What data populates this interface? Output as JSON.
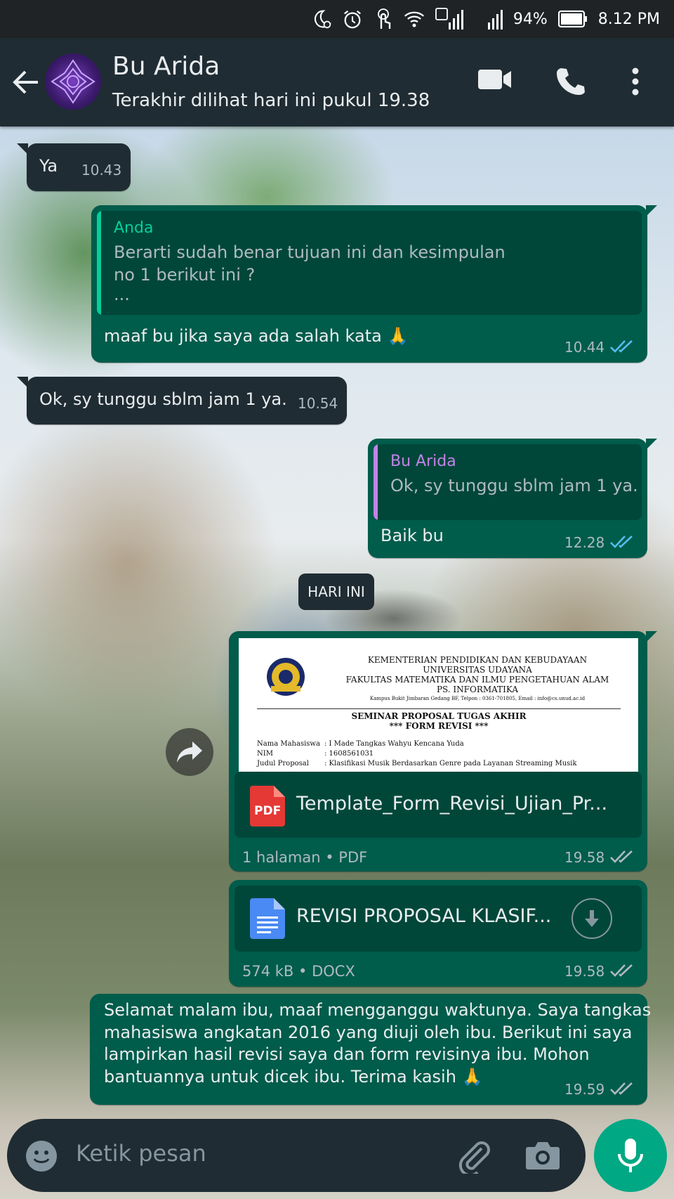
{
  "status_bar": {
    "battery": "94%",
    "time": "8.12 PM",
    "sim1": "1",
    "sim2": "2"
  },
  "header": {
    "contact_name": "Bu Arida",
    "last_seen": "Terakhir dilihat hari ini pukul 19.38"
  },
  "messages": {
    "m1": {
      "text": "Ya",
      "time": "10.43"
    },
    "m2": {
      "quote_author": "Anda",
      "quote_line1": "Berarti sudah benar tujuan ini dan kesimpulan",
      "quote_line2": "no 1 berikut ini ?",
      "quote_line3": "...",
      "text": "maaf bu jika saya ada salah kata 🙏",
      "time": "10.44"
    },
    "m3": {
      "text": "Ok, sy tunggu sblm jam 1 ya.",
      "time": "10.54"
    },
    "m4": {
      "quote_author": "Bu Arida",
      "quote_text": "Ok, sy tunggu sblm jam 1 ya.",
      "text": "Baik bu",
      "time": "12.28"
    },
    "date_chip": "HARI INI",
    "m5": {
      "preview": {
        "l1": "KEMENTERIAN PENDIDIKAN DAN KEBUDAYAAN",
        "l2": "UNIVERSITAS UDAYANA",
        "l3": "FAKULTAS MATEMATIKA DAN ILMU PENGETAHUAN ALAM",
        "l4": "PS. INFORMATIKA",
        "l5": "Kampus Bukit Jimbaran Gedang BF, Telpon : 0361-701805, Email : info@cs.unud.ac.id",
        "t1": "SEMINAR PROPOSAL TUGAS AKHIR",
        "t2": "*** FORM REVISI ***",
        "r1k": "Nama Mahasiswa",
        "r1v": ": I Made Tangkas Wahyu Kencana Yuda",
        "r2k": "NIM",
        "r2v": ": 1608561031",
        "r3k": "Judul Proposal",
        "r3v": ": Klasifikasi Musik Berdasarkan Genre pada Layanan Streaming Musik"
      },
      "file_badge": "PDF",
      "file_name": "Template_Form_Revisi_Ujian_Pr...",
      "meta": "1 halaman • PDF",
      "time": "19.58"
    },
    "m6": {
      "file_name": "REVISI PROPOSAL KLASIF...",
      "meta": "574 kB • DOCX",
      "time": "19.58"
    },
    "m7": {
      "line1": "Selamat malam ibu, maaf mengganggu waktunya. Saya tangkas",
      "line2": "mahasiswa angkatan 2016 yang diuji oleh ibu. Berikut ini saya",
      "line3": "lampirkan hasil revisi saya dan form revisinya ibu. Mohon",
      "line4": "bantuannya untuk dicek ibu. Terima kasih 🙏",
      "time": "19.59"
    }
  },
  "input": {
    "placeholder": "Ketik pesan"
  },
  "colors": {
    "outgoing": "#005c4b",
    "incoming": "#202c33",
    "read_ticks": "#53bdeb",
    "sent_ticks": "#aebac1",
    "accent": "#00a884"
  }
}
